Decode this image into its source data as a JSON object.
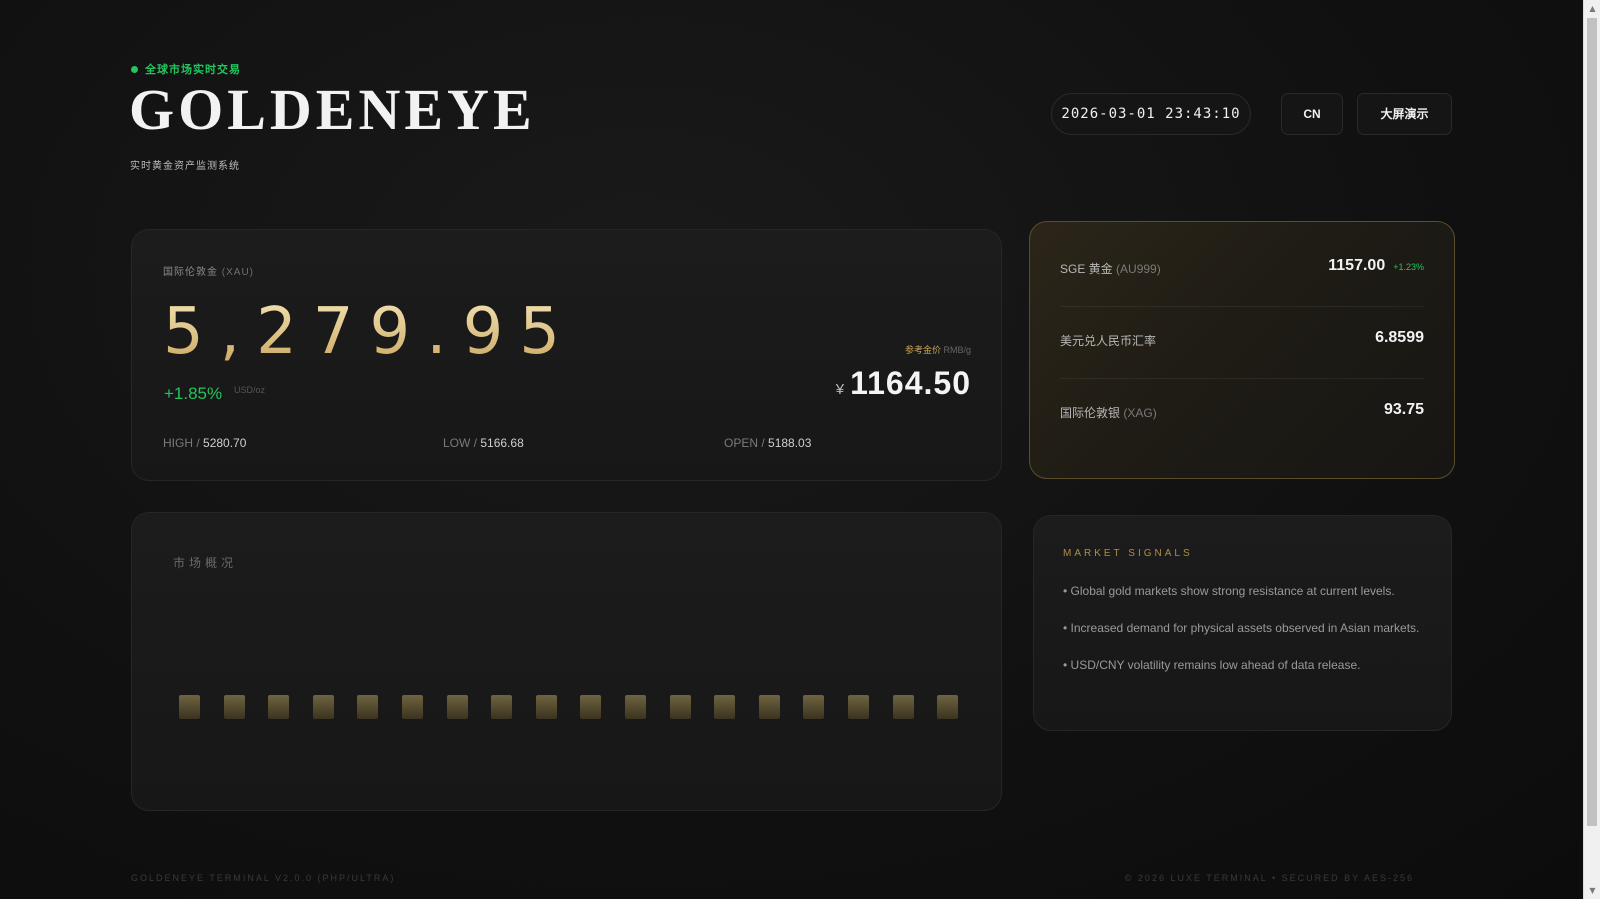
{
  "header": {
    "live_tag": "全球市场实时交易",
    "brand": "GOLDENEYE",
    "subtitle": "实时黄金资产监测系统",
    "datetime": "2026-03-01 23:43:10",
    "lang_button": "CN",
    "display_button": "大屏演示"
  },
  "main_card": {
    "label": "国际伦敦金",
    "label_code": "(XAU)",
    "price": "5,279.95",
    "change": "+1.85%",
    "unit": "USD/oz",
    "ref_label": "参考金价",
    "ref_unit": "RMB/g",
    "ref_currency": "¥",
    "ref_value": "1164.50",
    "stats": {
      "high_label": "HIGH /",
      "high_value": "5280.70",
      "low_label": "LOW /",
      "low_value": "5166.68",
      "open_label": "OPEN /",
      "open_value": "5188.03"
    }
  },
  "side_card": {
    "rows": [
      {
        "name": "SGE 黄金",
        "sub": "(AU999)",
        "value": "1157.00",
        "pct": "+1.23%"
      },
      {
        "name": "美元兑人民币汇率",
        "sub": "",
        "value": "6.8599",
        "pct": ""
      },
      {
        "name": "国际伦敦银",
        "sub": "(XAG)",
        "value": "93.75",
        "pct": ""
      }
    ]
  },
  "overview": {
    "title": "市场概况",
    "bar_count": 19
  },
  "signals": {
    "title": "MARKET SIGNALS",
    "items": [
      "• Global gold markets show strong resistance at current levels.",
      "• Increased demand for physical assets observed in Asian markets.",
      "• USD/CNY volatility remains low ahead of data release."
    ]
  },
  "footer": {
    "left": "GOLDENEYE TERMINAL V2.0.0 (PHP/ULTRA)",
    "right": "© 2026 LUXE TERMINAL • SECURED BY AES-256"
  },
  "colors": {
    "accent_gold": "#c9a35a",
    "positive": "#22c55e",
    "background": "#111111"
  }
}
